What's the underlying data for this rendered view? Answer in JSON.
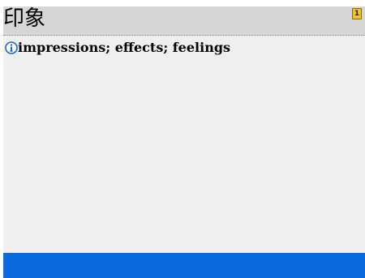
{
  "entry": {
    "headword": "印象",
    "page_badge": "1",
    "sense_number_icon": "info-circle-number-icon",
    "definition": "impressions; effects; feelings"
  },
  "colors": {
    "header_background": "#d6d6d6",
    "content_background": "#efefef",
    "footer_bar": "#0a6be0",
    "badge": "#f2c229",
    "sense_icon": "#1e66c7"
  }
}
